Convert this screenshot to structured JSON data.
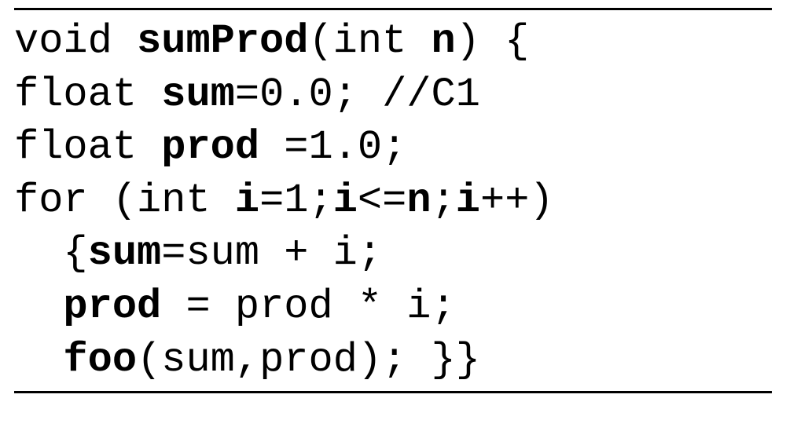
{
  "code": {
    "line1": {
      "t1": "void ",
      "t2": "sumProd",
      "t3": "(int ",
      "t4": "n",
      "t5": ") {"
    },
    "line2": {
      "t1": "float ",
      "t2": "sum",
      "t3": "=0.0; //C1"
    },
    "line3": {
      "t1": "float ",
      "t2": "prod",
      "t3": " =1.0;"
    },
    "line4": {
      "t1": "for (int ",
      "t2": "i",
      "t3": "=1;",
      "t4": "i",
      "t5": "<=",
      "t6": "n",
      "t7": ";",
      "t8": "i",
      "t9": "++)"
    },
    "line5": {
      "t1": "  {",
      "t2": "sum",
      "t3": "=sum + i;"
    },
    "line6": {
      "t1": "  ",
      "t2": "prod",
      "t3": " = prod * i;"
    },
    "line7": {
      "t1": "  ",
      "t2": "foo",
      "t3": "(sum,prod); }}"
    }
  }
}
